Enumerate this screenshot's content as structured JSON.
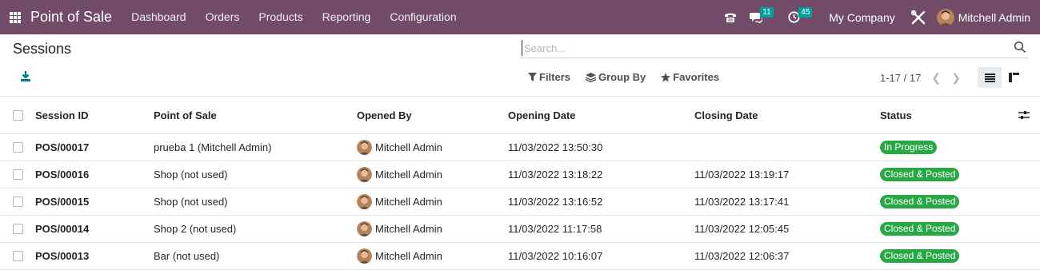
{
  "navbar": {
    "app_name": "Point of Sale",
    "menu": [
      "Dashboard",
      "Orders",
      "Products",
      "Reporting",
      "Configuration"
    ],
    "messages_count": "11",
    "activities_count": "45",
    "company": "My Company",
    "user_name": "Mitchell Admin",
    "colors": {
      "navbar_bg": "#714B67",
      "badge": "#00A09D"
    }
  },
  "control_panel": {
    "title": "Sessions",
    "search_placeholder": "Search...",
    "filters_label": "Filters",
    "groupby_label": "Group By",
    "favorites_label": "Favorites",
    "pager": "1-17 / 17"
  },
  "table": {
    "columns": [
      "Session ID",
      "Point of Sale",
      "Opened By",
      "Opening Date",
      "Closing Date",
      "Status"
    ],
    "rows": [
      {
        "id": "POS/00017",
        "pos": "prueba 1 (Mitchell Admin)",
        "opened_by": "Mitchell Admin",
        "opening": "11/03/2022 13:50:30",
        "closing": "",
        "status": "In Progress"
      },
      {
        "id": "POS/00016",
        "pos": "Shop (not used)",
        "opened_by": "Mitchell Admin",
        "opening": "11/03/2022 13:18:22",
        "closing": "11/03/2022 13:19:17",
        "status": "Closed & Posted"
      },
      {
        "id": "POS/00015",
        "pos": "Shop (not used)",
        "opened_by": "Mitchell Admin",
        "opening": "11/03/2022 13:16:52",
        "closing": "11/03/2022 13:17:41",
        "status": "Closed & Posted"
      },
      {
        "id": "POS/00014",
        "pos": "Shop 2 (not used)",
        "opened_by": "Mitchell Admin",
        "opening": "11/03/2022 11:17:58",
        "closing": "11/03/2022 12:05:45",
        "status": "Closed & Posted"
      },
      {
        "id": "POS/00013",
        "pos": "Bar (not used)",
        "opened_by": "Mitchell Admin",
        "opening": "11/03/2022 10:16:07",
        "closing": "11/03/2022 12:06:37",
        "status": "Closed & Posted"
      }
    ],
    "status_color": "#28a745"
  }
}
